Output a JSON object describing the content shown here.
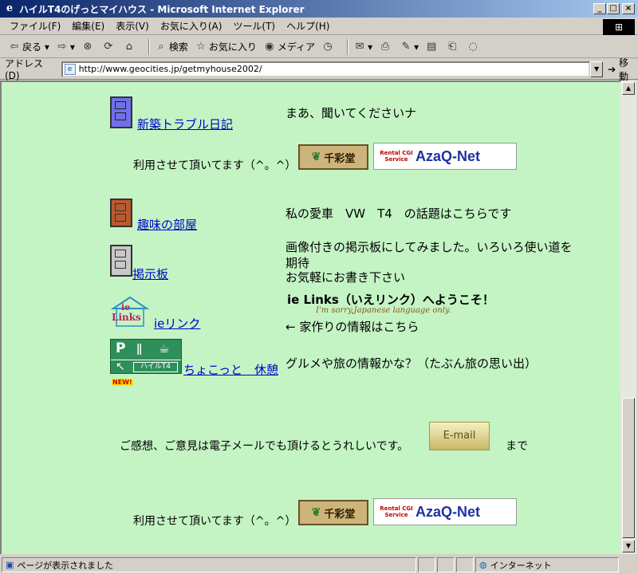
{
  "window": {
    "title": "ハイルT4のげっとマイハウス - Microsoft Internet Explorer"
  },
  "menu": [
    "ファイル(F)",
    "編集(E)",
    "表示(V)",
    "お気に入り(A)",
    "ツール(T)",
    "ヘルプ(H)"
  ],
  "toolbar": {
    "back": "戻る",
    "search": "検索",
    "favorites": "お気に入り",
    "media": "メディア"
  },
  "address": {
    "label": "アドレス(D)",
    "url": "http://www.geocities.jp/getmyhouse2002/",
    "go": "移動"
  },
  "content": {
    "row1": {
      "link": "新築トラブル日記",
      "desc": "まあ、聞いてくださいナ"
    },
    "credit_top": "利用させて頂いてます（^。^）",
    "row2": {
      "link": "趣味の部屋",
      "desc": "私の愛車　VW　T4　の話題はこちらです"
    },
    "row3": {
      "link": "掲示板",
      "desc_line1": "画像付きの掲示板にしてみました。いろいろ使い道を",
      "desc_line2": "期待",
      "desc_line3": "お気軽にお書き下さい"
    },
    "row4": {
      "icon_text_1": "ie",
      "icon_text_2": "Links",
      "link": "ieリンク",
      "banner_title": "ie Links（いえリンク）へようこそ！",
      "banner_sub": "I'm sorry,Japanese language only.",
      "desc": "← 家作りの情報はこちら"
    },
    "row5": {
      "sign_label": "ハイルT4",
      "new_badge": "NEW!",
      "link": "ちょこっと　休憩",
      "desc": "グルメや旅の情報かな？（たぶん旅の思い出）"
    },
    "feedback": {
      "text": "ご感想、ご意見は電子メールでも頂けるとうれしいです。",
      "email_button": "E-mail",
      "tail": "まで"
    },
    "credit_bottom": "利用させて頂いてます（^。^）",
    "banner_senshodo": "千彩堂",
    "banner_azaq_small": "Rental CGI Service",
    "banner_azaq_big": "AzaQ-Net"
  },
  "status": {
    "text": "ページが表示されました",
    "zone": "インターネット"
  }
}
